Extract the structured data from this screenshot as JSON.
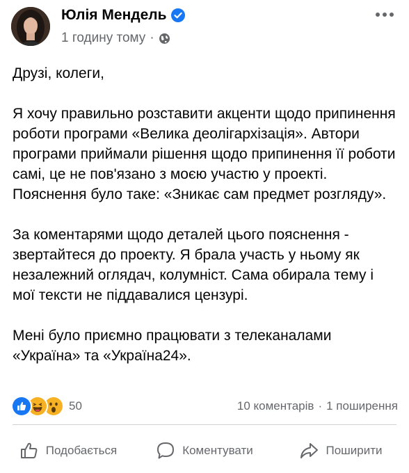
{
  "post": {
    "author": "Юлія Мендель",
    "time": "1 годину тому",
    "separator": "·",
    "paragraphs": [
      "Друзі, колеги,",
      "Я хочу правильно розставити акценти щодо припинення роботи програми «Велика деолігархізація». Автори програми приймали рішення щодо припинення її роботи самі, це не пов'язано з моєю участю у проекті. Пояснення було таке: «Зникає сам предмет розгляду».",
      "За коментарями щодо деталей цього пояснення - звертайтеся до проекту. Я брала участь у ньому як незалежний оглядач, колумніст. Сама обирала тему і мої тексти не піддавалися цензурі.",
      "Мені було приємно працювати з телеканалами «Україна» та «Україна24»."
    ]
  },
  "stats": {
    "reactions_count": "50",
    "comments": "10 коментарів",
    "dot": "·",
    "shares": "1 поширення"
  },
  "actions": {
    "like": "Подобається",
    "comment": "Коментувати",
    "share": "Поширити"
  },
  "icons": {
    "verified": "verified-badge-icon",
    "audience": "globe-icon",
    "more": "more-options-icon",
    "reactions": [
      "like-reaction-icon",
      "haha-reaction-icon",
      "wow-reaction-icon"
    ]
  },
  "colors": {
    "accent": "#1877f2",
    "secondary_text": "#65676b",
    "reaction_yellow": "#f7b125"
  }
}
